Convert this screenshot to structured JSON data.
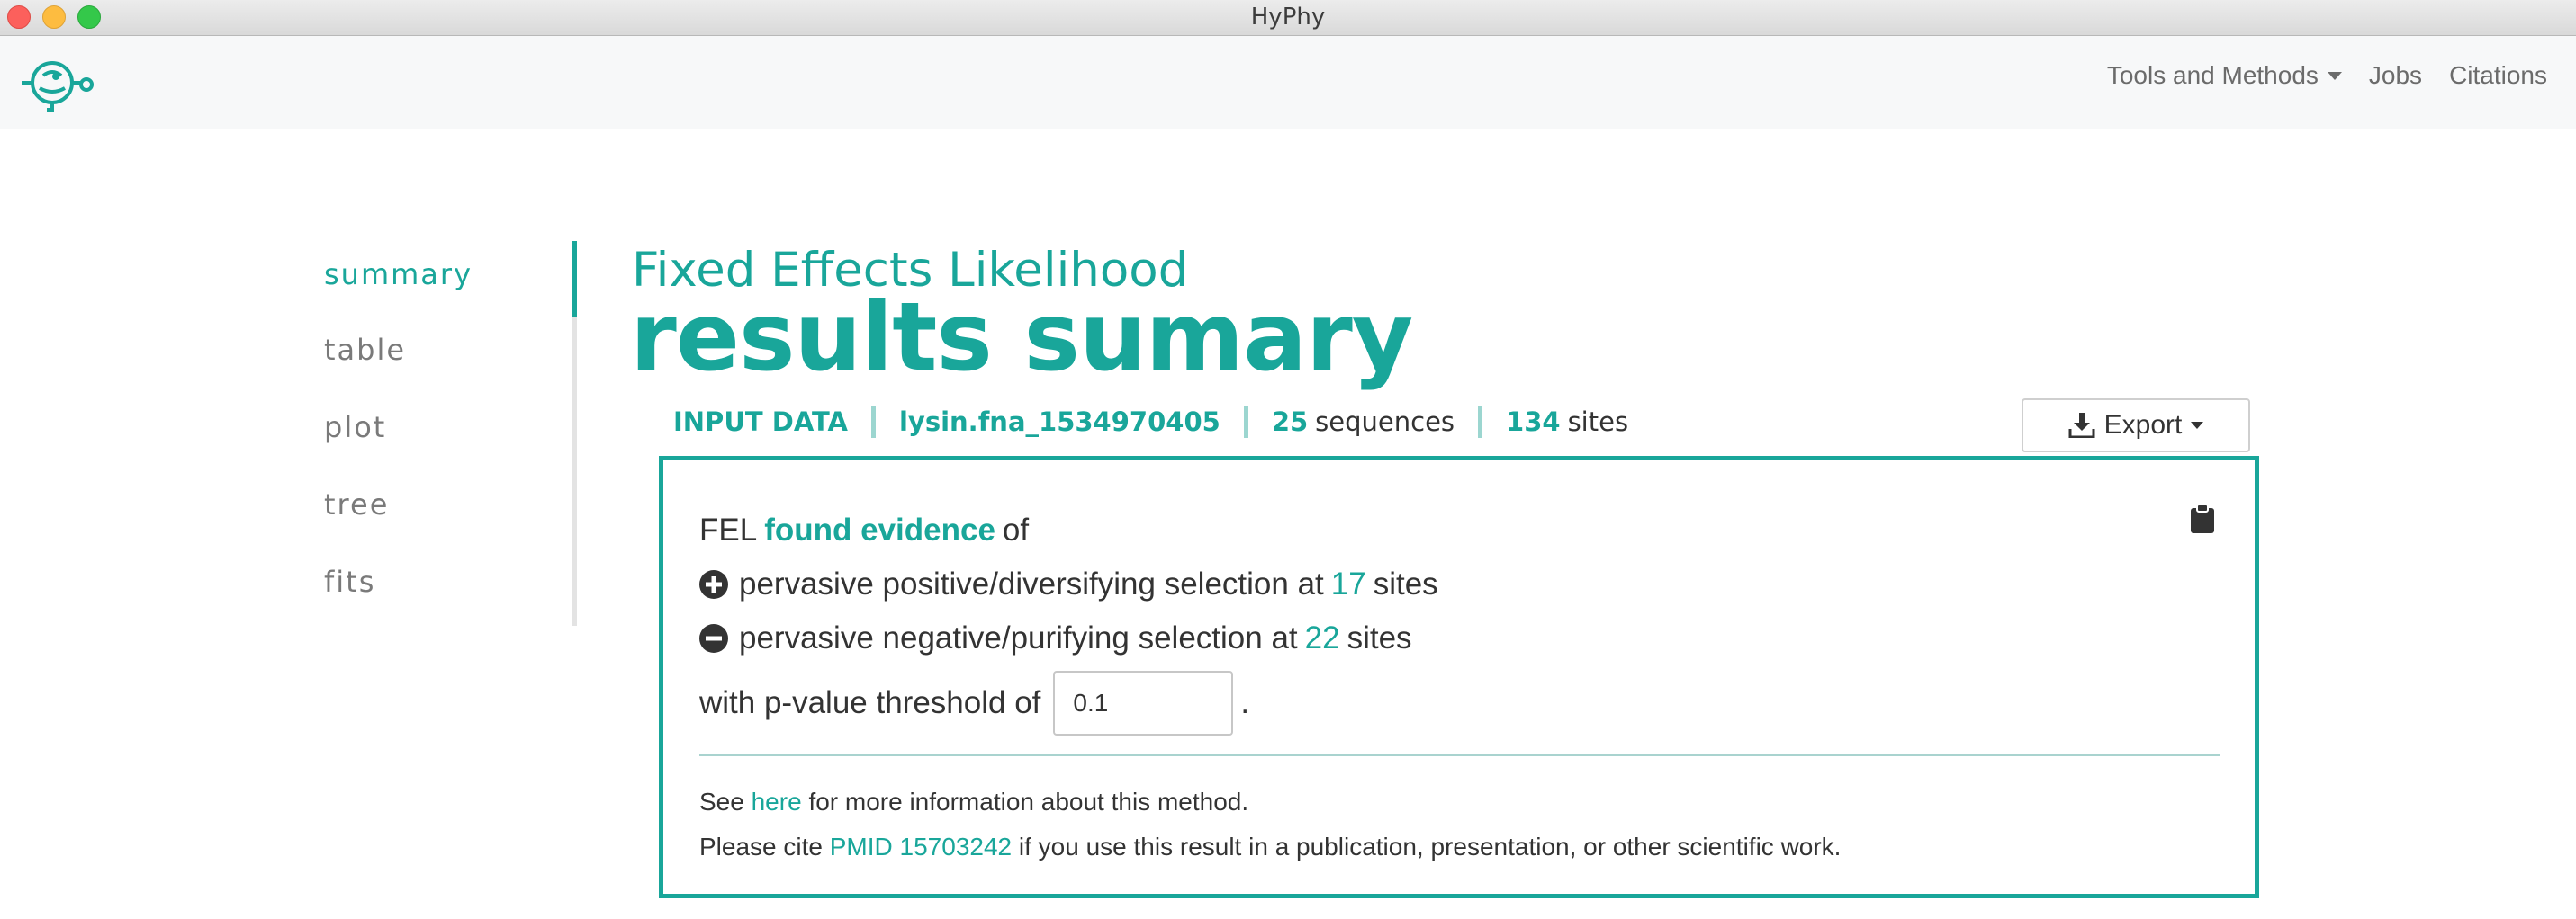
{
  "window": {
    "title": "HyPhy"
  },
  "navbar": {
    "logo": "hyphy-logo",
    "links": [
      {
        "label": "Tools and Methods",
        "dropdown": true
      },
      {
        "label": "Jobs"
      },
      {
        "label": "Citations"
      }
    ]
  },
  "sidenav": {
    "items": [
      {
        "label": "summary",
        "active": true
      },
      {
        "label": "table"
      },
      {
        "label": "plot"
      },
      {
        "label": "tree"
      },
      {
        "label": "fits"
      }
    ]
  },
  "header": {
    "subtitle": "Fixed Effects Likelihood",
    "title": "results sumary"
  },
  "input_data": {
    "label": "INPUT DATA",
    "filename": "lysin.fna_1534970405",
    "sequences_count": "25",
    "sequences_label": "sequences",
    "sites_count": "134",
    "sites_label": "sites"
  },
  "export": {
    "label": "Export"
  },
  "summary": {
    "intro_prefix": "FEL",
    "intro_highlight": "found evidence",
    "intro_suffix": "of",
    "positive_text": "pervasive positive/diversifying selection at",
    "positive_count": "17",
    "positive_unit": "sites",
    "negative_text": "pervasive negative/purifying selection at",
    "negative_count": "22",
    "negative_unit": "sites",
    "threshold_label": "with p-value threshold of",
    "threshold_value": "0.1",
    "threshold_end": "."
  },
  "footer": {
    "see_prefix": "See",
    "see_link": "here",
    "see_suffix": "for more information about this method.",
    "cite_prefix": "Please cite",
    "cite_link": "PMID 15703242",
    "cite_suffix": "if you use this result in a publication, presentation, or other scientific work."
  },
  "colors": {
    "accent": "#19a69a",
    "text": "#333333",
    "muted": "#7a7a7a"
  }
}
